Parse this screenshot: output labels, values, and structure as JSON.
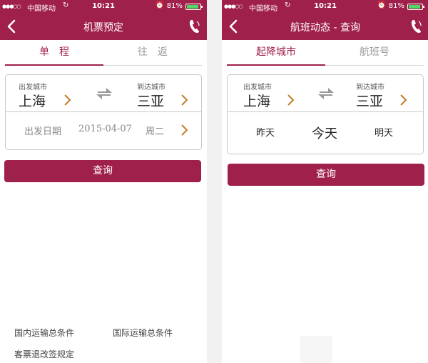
{
  "statusbar": {
    "dots": "●●●○○",
    "carrier": "中国移动",
    "sync_icon": "↻",
    "time": "10:21",
    "alarm_icon": "⏰",
    "battery_pct": "81%"
  },
  "left": {
    "title": "机票预定",
    "tabs": [
      "单　程",
      "往　返"
    ],
    "depart_label": "出发城市",
    "depart_city": "上海",
    "arrive_label": "到达城市",
    "arrive_city": "三亚",
    "date_label": "出发日期",
    "date_value": "2015-04-07",
    "date_week": "周二",
    "query_button": "查询",
    "footer_links": [
      "国内运输总条件",
      "国际运输总条件",
      "客票退改签规定"
    ]
  },
  "right": {
    "title": "航班动态 - 查询",
    "tabs": [
      "起降城市",
      "航班号"
    ],
    "depart_label": "出发城市",
    "depart_city": "上海",
    "arrive_label": "到达城市",
    "arrive_city": "三亚",
    "days": [
      "昨天",
      "今天",
      "明天"
    ],
    "query_button": "查询"
  },
  "colors": {
    "brand": "#a0204c",
    "chevron": "#c07d2a",
    "battery": "#4cd964"
  }
}
